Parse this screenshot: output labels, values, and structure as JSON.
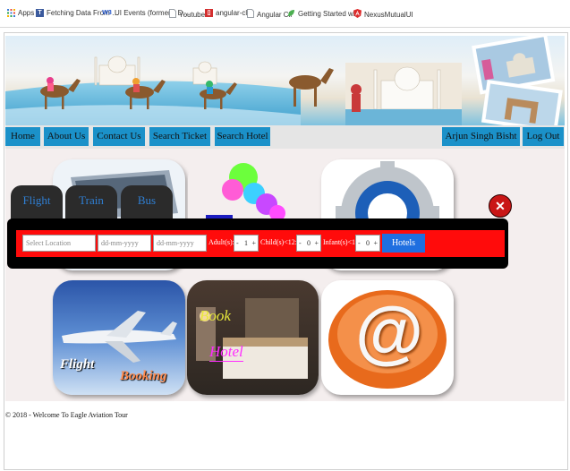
{
  "bookmarks": [
    {
      "label": "Apps",
      "icon": "apps-grid-icon",
      "color": "#3b7bd8"
    },
    {
      "label": "Fetching Data From …",
      "icon": "page-icon",
      "color": "#3b5a9d"
    },
    {
      "label": "UI Events (formerly D…",
      "icon": "w3-icon",
      "color": "#1e52c9"
    },
    {
      "label": "Youtube",
      "icon": "document-icon",
      "color": "#9aa0a6"
    },
    {
      "label": "angular-cli",
      "icon": "bookmark-red-icon",
      "color": "#d32f2f"
    },
    {
      "label": "Angular Cli",
      "icon": "document-icon",
      "color": "#9aa0a6"
    },
    {
      "label": "Getting Started with",
      "icon": "leaf-icon",
      "color": "#4caf50"
    },
    {
      "label": "NexusMutualUI",
      "icon": "angular-icon",
      "color": "#dd2c2c"
    }
  ],
  "nav": {
    "home": "Home",
    "about": "About Us",
    "contact": "Contact Us",
    "search_ticket": "Search Ticket",
    "search_hotel": "Search Hotel",
    "user": "Arjun Singh Bisht",
    "logout": "Log Out"
  },
  "tabs": {
    "flight": "Flight",
    "train": "Train",
    "bus": "Bus"
  },
  "search": {
    "location_placeholder": "Select Location",
    "checkin_placeholder": "dd-mm-yyyy",
    "checkout_placeholder": "dd-mm-yyyy",
    "adult_label": "Adult(s):",
    "adult_value": "1",
    "child_label": "Child(s)<12:",
    "child_value": "0",
    "infant_label": "Infant(s)<1:",
    "infant_value": "0",
    "minus": "-",
    "plus": "+",
    "hotels_button": "Hotels"
  },
  "tiles": {
    "flight_line1": "Flight",
    "flight_line2": "Booking",
    "hotel_line1": "Book",
    "hotel_line2": "Hotel",
    "at_symbol": "@"
  },
  "close_symbol": "✕",
  "footer": "© 2018 - Welcome To Eagle Aviation Tour",
  "colors": {
    "nav_blue": "#1b91c9",
    "search_red": "#ff0b0b",
    "hotels_blue": "#1f6fe0",
    "tab_text": "#2f7fd3"
  }
}
